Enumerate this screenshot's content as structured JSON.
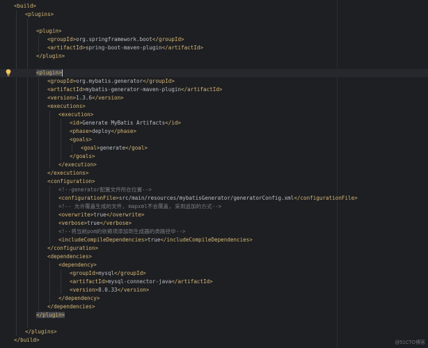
{
  "editor": {
    "lines": [
      {
        "indent": 0,
        "parts": [
          {
            "t": "tag",
            "v": "<build>"
          }
        ]
      },
      {
        "indent": 1,
        "parts": [
          {
            "t": "tag",
            "v": "<plugins>"
          }
        ]
      },
      {
        "indent": 0,
        "parts": []
      },
      {
        "indent": 2,
        "parts": [
          {
            "t": "tag",
            "v": "<plugin>"
          }
        ]
      },
      {
        "indent": 3,
        "parts": [
          {
            "t": "tag",
            "v": "<groupId>"
          },
          {
            "t": "text",
            "v": "org.springframework.boot"
          },
          {
            "t": "tag",
            "v": "</groupId>"
          }
        ]
      },
      {
        "indent": 3,
        "parts": [
          {
            "t": "tag",
            "v": "<artifactId>"
          },
          {
            "t": "text",
            "v": "spring-boot-maven-plugin"
          },
          {
            "t": "tag",
            "v": "</artifactId>"
          }
        ]
      },
      {
        "indent": 2,
        "parts": [
          {
            "t": "tag",
            "v": "</plugin>"
          }
        ]
      },
      {
        "indent": 0,
        "parts": []
      },
      {
        "indent": 2,
        "current": true,
        "parts": [
          {
            "t": "tag hl",
            "v": "<plugin>"
          },
          {
            "t": "caret",
            "v": ""
          }
        ]
      },
      {
        "indent": 3,
        "parts": [
          {
            "t": "tag",
            "v": "<groupId>"
          },
          {
            "t": "text",
            "v": "org.mybatis.generator"
          },
          {
            "t": "tag",
            "v": "</groupId>"
          }
        ]
      },
      {
        "indent": 3,
        "parts": [
          {
            "t": "tag",
            "v": "<artifactId>"
          },
          {
            "t": "text",
            "v": "mybatis-generator-maven-plugin"
          },
          {
            "t": "tag",
            "v": "</artifactId>"
          }
        ]
      },
      {
        "indent": 3,
        "parts": [
          {
            "t": "tag",
            "v": "<version>"
          },
          {
            "t": "text",
            "v": "1.3.6"
          },
          {
            "t": "tag",
            "v": "</version>"
          }
        ]
      },
      {
        "indent": 3,
        "parts": [
          {
            "t": "tag",
            "v": "<executions>"
          }
        ]
      },
      {
        "indent": 4,
        "parts": [
          {
            "t": "tag",
            "v": "<execution>"
          }
        ]
      },
      {
        "indent": 5,
        "parts": [
          {
            "t": "tag",
            "v": "<id>"
          },
          {
            "t": "text",
            "v": "Generate MyBatis Artifacts"
          },
          {
            "t": "tag",
            "v": "</id>"
          }
        ]
      },
      {
        "indent": 5,
        "parts": [
          {
            "t": "tag",
            "v": "<phase>"
          },
          {
            "t": "text",
            "v": "deploy"
          },
          {
            "t": "tag",
            "v": "</phase>"
          }
        ]
      },
      {
        "indent": 5,
        "parts": [
          {
            "t": "tag",
            "v": "<goals>"
          }
        ]
      },
      {
        "indent": 6,
        "parts": [
          {
            "t": "tag",
            "v": "<goal>"
          },
          {
            "t": "text",
            "v": "generate"
          },
          {
            "t": "tag",
            "v": "</goal>"
          }
        ]
      },
      {
        "indent": 5,
        "parts": [
          {
            "t": "tag",
            "v": "</goals>"
          }
        ]
      },
      {
        "indent": 4,
        "parts": [
          {
            "t": "tag",
            "v": "</execution>"
          }
        ]
      },
      {
        "indent": 3,
        "parts": [
          {
            "t": "tag",
            "v": "</executions>"
          }
        ]
      },
      {
        "indent": 3,
        "parts": [
          {
            "t": "tag",
            "v": "<configuration>"
          }
        ]
      },
      {
        "indent": 4,
        "parts": [
          {
            "t": "comment",
            "v": "<!--generator配置文件所在位置-->"
          }
        ]
      },
      {
        "indent": 4,
        "parts": [
          {
            "t": "tag",
            "v": "<configurationFile>"
          },
          {
            "t": "text",
            "v": "src/main/resources/mybatisGenerator/generatorConfig.xml"
          },
          {
            "t": "tag",
            "v": "</configurationFile>"
          }
        ]
      },
      {
        "indent": 4,
        "parts": [
          {
            "t": "comment",
            "v": "<!-- 允许覆盖生成的文件, mapxml不会覆盖, 采用追加的方式-->"
          }
        ]
      },
      {
        "indent": 4,
        "parts": [
          {
            "t": "tag",
            "v": "<overwrite>"
          },
          {
            "t": "text",
            "v": "true"
          },
          {
            "t": "tag",
            "v": "</overwrite>"
          }
        ]
      },
      {
        "indent": 4,
        "parts": [
          {
            "t": "tag",
            "v": "<verbose>"
          },
          {
            "t": "text",
            "v": "true"
          },
          {
            "t": "tag",
            "v": "</verbose>"
          }
        ]
      },
      {
        "indent": 4,
        "parts": [
          {
            "t": "comment",
            "v": "<!--将当前pom的依赖项添加到生成器的类路径中-->"
          }
        ]
      },
      {
        "indent": 4,
        "parts": [
          {
            "t": "tag",
            "v": "<includeCompileDependencies>"
          },
          {
            "t": "text",
            "v": "true"
          },
          {
            "t": "tag",
            "v": "</includeCompileDependencies>"
          }
        ]
      },
      {
        "indent": 3,
        "parts": [
          {
            "t": "tag",
            "v": "</configuration>"
          }
        ]
      },
      {
        "indent": 3,
        "parts": [
          {
            "t": "tag",
            "v": "<dependencies>"
          }
        ]
      },
      {
        "indent": 4,
        "parts": [
          {
            "t": "tag",
            "v": "<dependency>"
          }
        ]
      },
      {
        "indent": 5,
        "parts": [
          {
            "t": "tag",
            "v": "<groupId>"
          },
          {
            "t": "text",
            "v": "mysql"
          },
          {
            "t": "tag",
            "v": "</groupId>"
          }
        ]
      },
      {
        "indent": 5,
        "parts": [
          {
            "t": "tag",
            "v": "<artifactId>"
          },
          {
            "t": "text",
            "v": "mysql-connector-java"
          },
          {
            "t": "tag",
            "v": "</artifactId>"
          }
        ]
      },
      {
        "indent": 5,
        "parts": [
          {
            "t": "tag",
            "v": "<version>"
          },
          {
            "t": "text",
            "v": "8.0.33"
          },
          {
            "t": "tag",
            "v": "</version>"
          }
        ]
      },
      {
        "indent": 4,
        "parts": [
          {
            "t": "tag",
            "v": "</dependency>"
          }
        ]
      },
      {
        "indent": 3,
        "parts": [
          {
            "t": "tag",
            "v": "</dependencies>"
          }
        ]
      },
      {
        "indent": 2,
        "parts": [
          {
            "t": "tag hl",
            "v": "</plugin>"
          }
        ]
      },
      {
        "indent": 0,
        "parts": []
      },
      {
        "indent": 1,
        "parts": [
          {
            "t": "tag",
            "v": "</plugins>"
          }
        ]
      },
      {
        "indent": 0,
        "parts": [
          {
            "t": "tag",
            "v": "</build>"
          }
        ]
      }
    ],
    "intention_icon": "lightbulb-icon"
  },
  "watermark": "@51CTO博客",
  "colors": {
    "background": "#1e1f22",
    "tag": "#d5b778",
    "text": "#bcbec4",
    "comment": "#7a7e85",
    "current_line": "#26282e",
    "bulb": "#f2c55c"
  }
}
